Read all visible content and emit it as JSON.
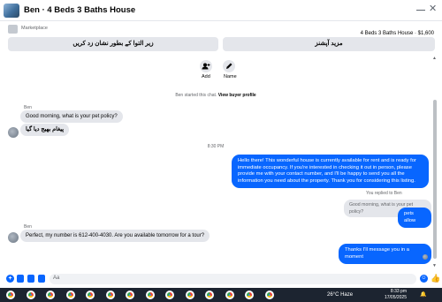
{
  "header": {
    "title": "Ben · 4 Beds 3 Baths House",
    "close_glyph": "✕"
  },
  "marketplace": {
    "label": "Marketplace",
    "product_title": "4 Beds 3 Baths House · $1,600",
    "btn_left": "زیر التوا کے بطور نشان زد کریں",
    "btn_right": "مزید آپشنز"
  },
  "actions": {
    "add_label": "Add",
    "name_label": "Name"
  },
  "started": {
    "text": "Ben started this chat.",
    "link": "View buyer profile"
  },
  "messages": {
    "ben_name_1": "Ben",
    "in1": "Good morning, what is your pet policy?",
    "in2": "پیغام بھیج دیا گیا",
    "timestamp": "8:30 PM",
    "out1": "Hello there! This wonderful house is currently available for rent and is ready for immediate occupancy. If you're interested in checking it out in person, please provide me with your contact number, and I'll be happy to send you all the information you need about the property. Thank you for considering this listing.",
    "replied": "You replied to Ben",
    "quoted": "Good morning, what is your pet policy?",
    "out2": "pets allow",
    "ben_name_2": "Ben",
    "in3": "Perfect, my number is 612-400-4030. Are you available tomorrow for a tour?",
    "out3": "Thanks I'll message you in a moment"
  },
  "composer": {
    "placeholder": "Aa"
  },
  "taskbar": {
    "weather": "26°C  Haze",
    "time": "8:33 pm",
    "date": "17/05/2025",
    "app_count": 14
  },
  "colors": {
    "accent": "#0866ff",
    "incoming_bubble": "#e4e6eb",
    "taskbar_bg": "#1c2430"
  }
}
